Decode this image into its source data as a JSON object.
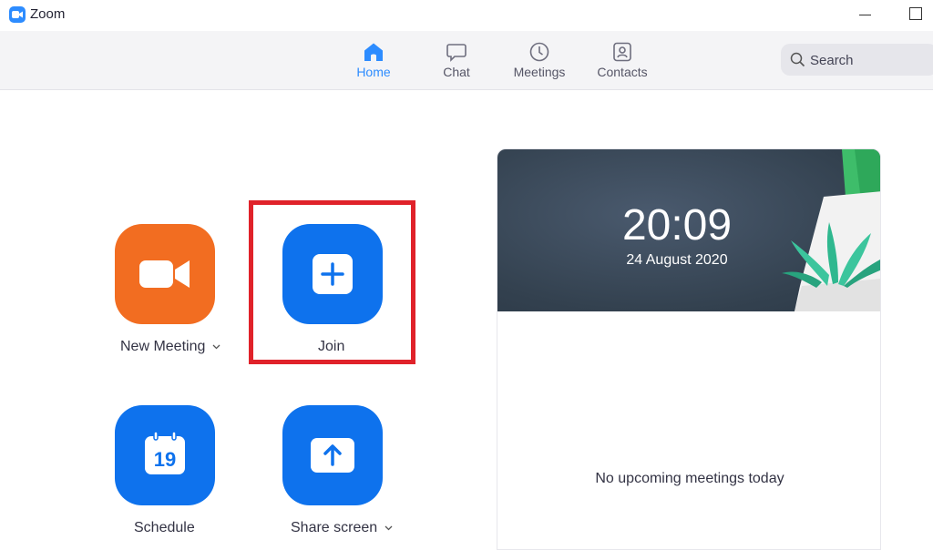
{
  "window": {
    "title": "Zoom",
    "icons": {
      "logo": "zoom-camera-icon",
      "minimize": "minimize-icon",
      "maximize": "maximize-icon"
    }
  },
  "nav": {
    "items": [
      {
        "label": "Home",
        "icon": "home-icon",
        "active": true
      },
      {
        "label": "Chat",
        "icon": "chat-bubble-icon",
        "active": false
      },
      {
        "label": "Meetings",
        "icon": "clock-icon",
        "active": false
      },
      {
        "label": "Contacts",
        "icon": "contact-card-icon",
        "active": false
      }
    ],
    "search": {
      "placeholder": "Search",
      "icon": "search-icon"
    }
  },
  "actions": {
    "new_meeting": {
      "label": "New Meeting",
      "icon": "video-camera-icon",
      "color": "#f26d21"
    },
    "join": {
      "label": "Join",
      "icon": "plus-icon",
      "color": "#0e72ed"
    },
    "schedule": {
      "label": "Schedule",
      "icon": "calendar-icon",
      "calendar_day": "19",
      "color": "#0e72ed"
    },
    "share_screen": {
      "label": "Share screen",
      "icon": "upload-arrow-icon",
      "color": "#0e72ed"
    }
  },
  "panel": {
    "time": "20:09",
    "date": "24 August 2020",
    "empty_message": "No upcoming meetings today"
  },
  "colors": {
    "accent": "#2d8cff",
    "highlight": "#e0222a"
  }
}
